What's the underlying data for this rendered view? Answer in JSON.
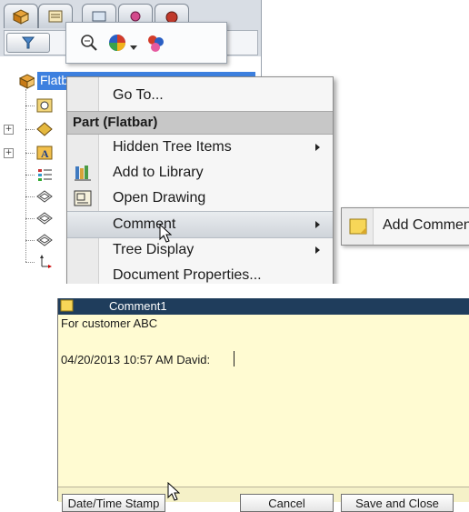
{
  "feature_tree": {
    "root_label": "Flatb"
  },
  "context_menu": {
    "go_to": "Go To...",
    "section_header": "Part (Flatbar)",
    "hidden_tree_items": "Hidden Tree Items",
    "add_to_library": "Add to Library",
    "open_drawing": "Open Drawing",
    "comment": "Comment",
    "tree_display": "Tree Display",
    "document_properties": "Document Properties..."
  },
  "comment_submenu": {
    "add_comment": "Add Commen"
  },
  "comment_window": {
    "title": "Comment1",
    "line1": "For customer ABC",
    "line2": "04/20/2013 10:57 AM  David:",
    "date_time_stamp": "Date/Time Stamp",
    "cancel": "Cancel",
    "save_and_close": "Save and Close"
  },
  "colors": {
    "selection": "#3d80df",
    "comment_background": "#fffbd2",
    "comment_titlebar": "#1f3d5c",
    "menu_header": "#c7c7c7"
  }
}
